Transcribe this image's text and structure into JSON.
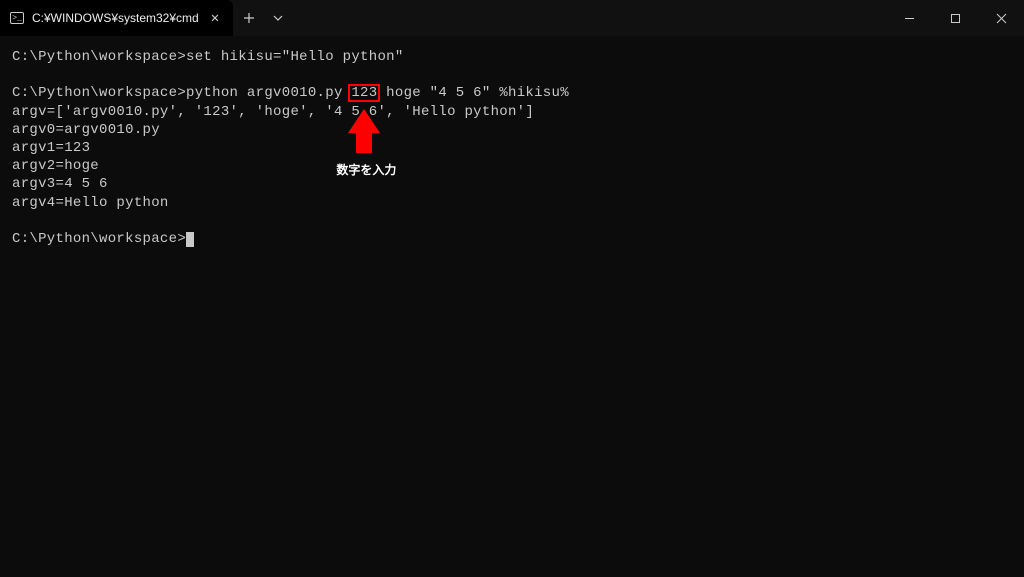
{
  "window": {
    "tab_title": "C:¥WINDOWS¥system32¥cmd"
  },
  "terminal": {
    "line1": "C:\\Python\\workspace>set hikisu=\"Hello python\"",
    "blank1": "",
    "line2a": "C:\\Python\\workspace>python argv0010.py ",
    "line2_hl": "123",
    "line2b": " hoge \"4 5 6\" %hikisu%",
    "line3": "argv=['argv0010.py', '123', 'hoge', '4 5 6', 'Hello python']",
    "line4": "argv0=argv0010.py",
    "line5": "argv1=123",
    "line6": "argv2=hoge",
    "line7": "argv3=4 5 6",
    "line8": "argv4=Hello python",
    "blank2": "",
    "prompt": "C:\\Python\\workspace>"
  },
  "annotation": {
    "label": "数字を入力"
  }
}
